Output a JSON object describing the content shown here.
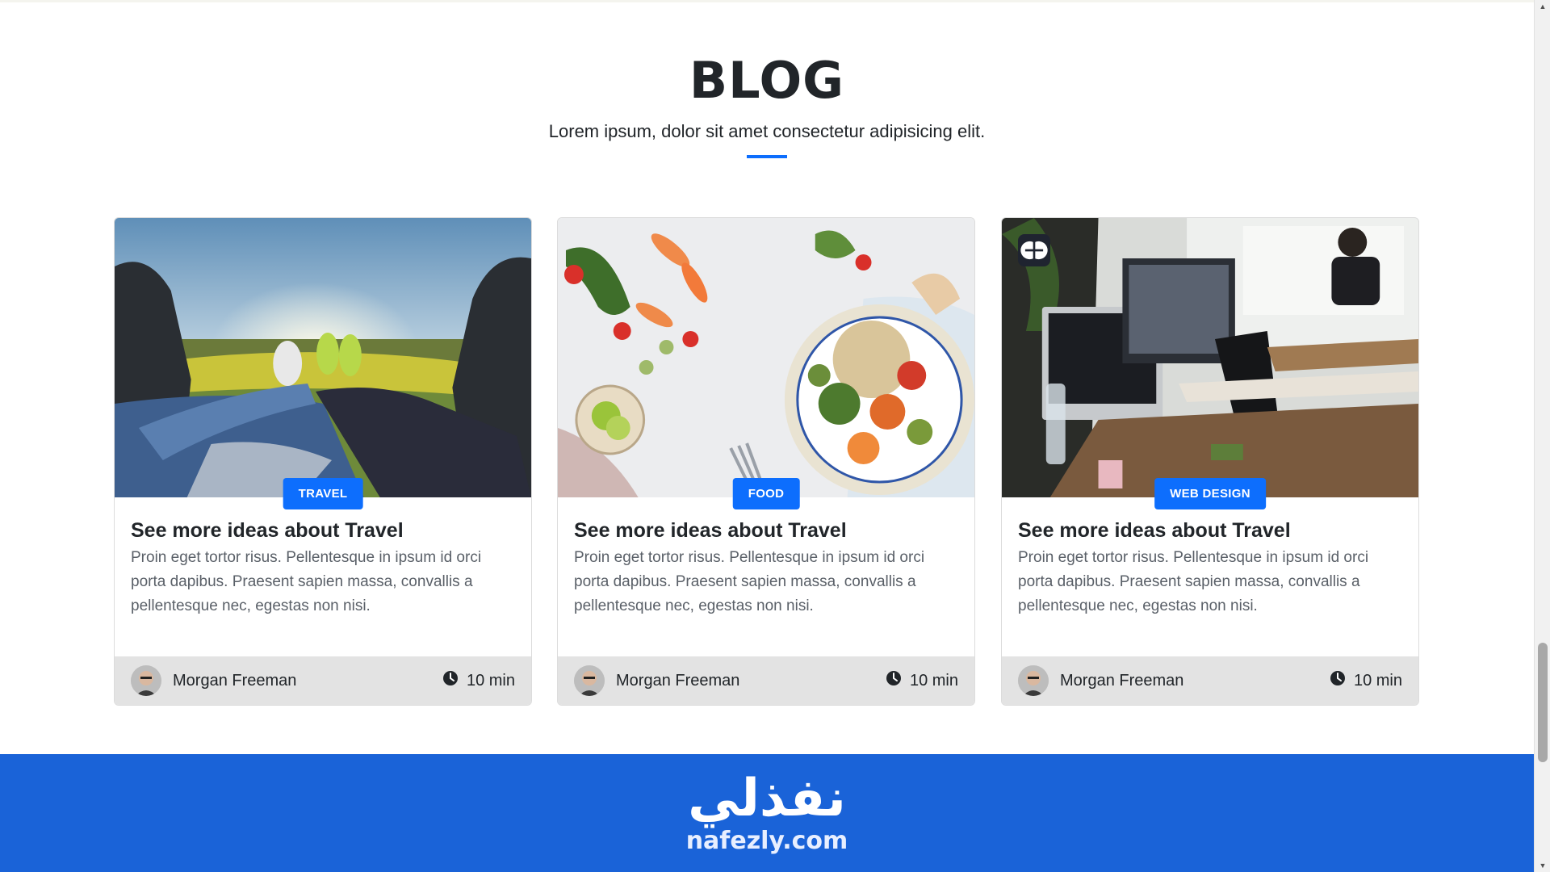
{
  "blog": {
    "title": "BLOG",
    "subtitle": "Lorem ipsum, dolor sit amet consectetur adipisicing elit."
  },
  "cards": [
    {
      "image": "travel-photo",
      "category": "TRAVEL",
      "title": "See more ideas about Travel",
      "text": "Proin eget tortor risus. Pellentesque in ipsum id orci porta dapibus. Praesent sapien massa, convallis a pellentesque nec, egestas non nisi.",
      "author": "Morgan Freeman",
      "read_time": "10 min"
    },
    {
      "image": "food-photo",
      "category": "FOOD",
      "title": "See more ideas about Travel",
      "text": "Proin eget tortor risus. Pellentesque in ipsum id orci porta dapibus. Praesent sapien massa, convallis a pellentesque nec, egestas non nisi.",
      "author": "Morgan Freeman",
      "read_time": "10 min"
    },
    {
      "image": "office-photo",
      "category": "WEB DESIGN",
      "title": "See more ideas about Travel",
      "text": "Proin eget tortor risus. Pellentesque in ipsum id orci porta dapibus. Praesent sapien massa, convallis a pellentesque nec, egestas non nisi.",
      "author": "Morgan Freeman",
      "read_time": "10 min"
    }
  ],
  "footer_brand": {
    "arabic": "نفذلي",
    "url": "nafezly.com"
  },
  "icons": {
    "clock": "clock-icon",
    "avatar": "avatar",
    "brain": "brain-icon"
  },
  "colors": {
    "accent": "#0d6efd",
    "footer_band": "#1a63d8",
    "card_footer": "#e3e3e3"
  }
}
